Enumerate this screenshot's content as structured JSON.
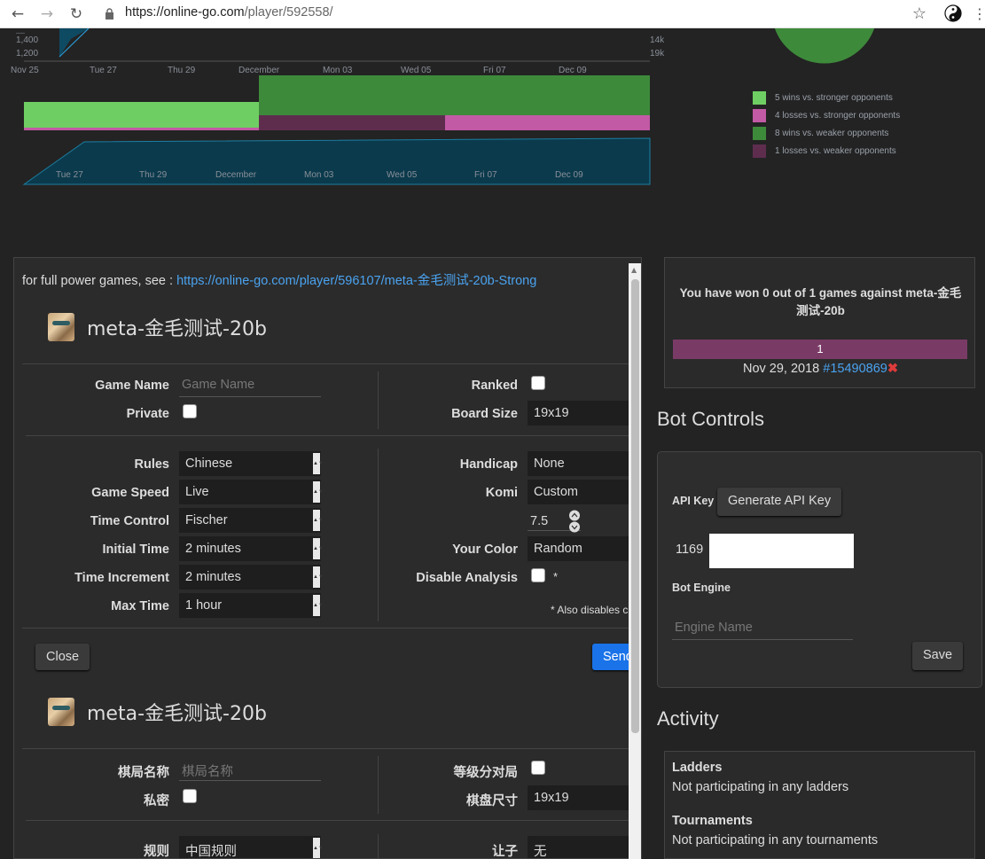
{
  "browser": {
    "url_host": "https://online-go.com",
    "url_path": "/player/592558/"
  },
  "rating_chart": {
    "y_ticks": [
      "1,400",
      "1,200"
    ],
    "y_ticks_right": [
      "14k",
      "19k"
    ],
    "x_ticks": [
      "Nov 25",
      "Tue 27",
      "Thu 29",
      "December",
      "Mon 03",
      "Wed 05",
      "Fri 07",
      "Dec 09"
    ],
    "nav_ticks": [
      "Tue 27",
      "Thu 29",
      "December",
      "Mon 03",
      "Wed 05",
      "Fri 07",
      "Dec 09"
    ]
  },
  "chart_data": {
    "type": "pie",
    "slices": [
      {
        "label": "5 wins vs. stronger opponents",
        "value": 5,
        "color": "#6fce63"
      },
      {
        "label": "4 losses vs. stronger opponents",
        "value": 4,
        "color": "#c25aa5"
      },
      {
        "label": "8 wins vs. weaker opponents",
        "value": 8,
        "color": "#3e8a3b"
      },
      {
        "label": "1 losses vs. weaker opponents",
        "value": 1,
        "color": "#5e2d4e"
      }
    ]
  },
  "modal": {
    "note_prefix": "for full power games, see : ",
    "note_link": "https://online-go.com/player/596107/meta-金毛测试-20b-Strong",
    "english": {
      "player_name": "meta-金毛测试-20b",
      "game_name_label": "Game Name",
      "game_name_placeholder": "Game Name",
      "private_label": "Private",
      "ranked_label": "Ranked",
      "board_size_label": "Board Size",
      "board_size_value": "19x19",
      "rules_label": "Rules",
      "rules_value": "Chinese",
      "game_speed_label": "Game Speed",
      "game_speed_value": "Live",
      "time_control_label": "Time Control",
      "time_control_value": "Fischer",
      "initial_time_label": "Initial Time",
      "initial_time_value": "2 minutes",
      "time_increment_label": "Time Increment",
      "time_increment_value": "2 minutes",
      "max_time_label": "Max Time",
      "max_time_value": "1 hour",
      "handicap_label": "Handicap",
      "handicap_value": "None",
      "komi_label": "Komi",
      "komi_value": "Custom",
      "komi_number": "7.5",
      "your_color_label": "Your Color",
      "your_color_value": "Random",
      "disable_analysis_label": "Disable Analysis",
      "disable_analysis_star": "*",
      "also_disables": "* Also disables c",
      "close_label": "Close",
      "send_label": "Send"
    },
    "chinese": {
      "player_name": "meta-金毛测试-20b",
      "game_name_label": "棋局名称",
      "game_name_placeholder": "棋局名称",
      "private_label": "私密",
      "ranked_label": "等级分对局",
      "board_size_label": "棋盘尺寸",
      "board_size_value": "19x19",
      "rules_label": "规则",
      "rules_value": "中国规则",
      "handicap_label": "让子",
      "handicap_value": "无"
    }
  },
  "versus": {
    "summary": "You have won 0 out of 1 games against meta-金毛测试-20b",
    "bar_value": "1",
    "date": "Nov 29, 2018 ",
    "game_link": "#15490869",
    "result_mark": "✖"
  },
  "bot_controls": {
    "title": "Bot Controls",
    "api_key_label": "API Key",
    "generate_label": "Generate API Key",
    "api_key_value": "1169",
    "bot_engine_label": "Bot Engine",
    "engine_placeholder": "Engine Name",
    "save_label": "Save"
  },
  "activity": {
    "title": "Activity",
    "ladders_title": "Ladders",
    "ladders_text": "Not participating in any ladders",
    "tournaments_title": "Tournaments",
    "tournaments_text": "Not participating in any tournaments"
  }
}
